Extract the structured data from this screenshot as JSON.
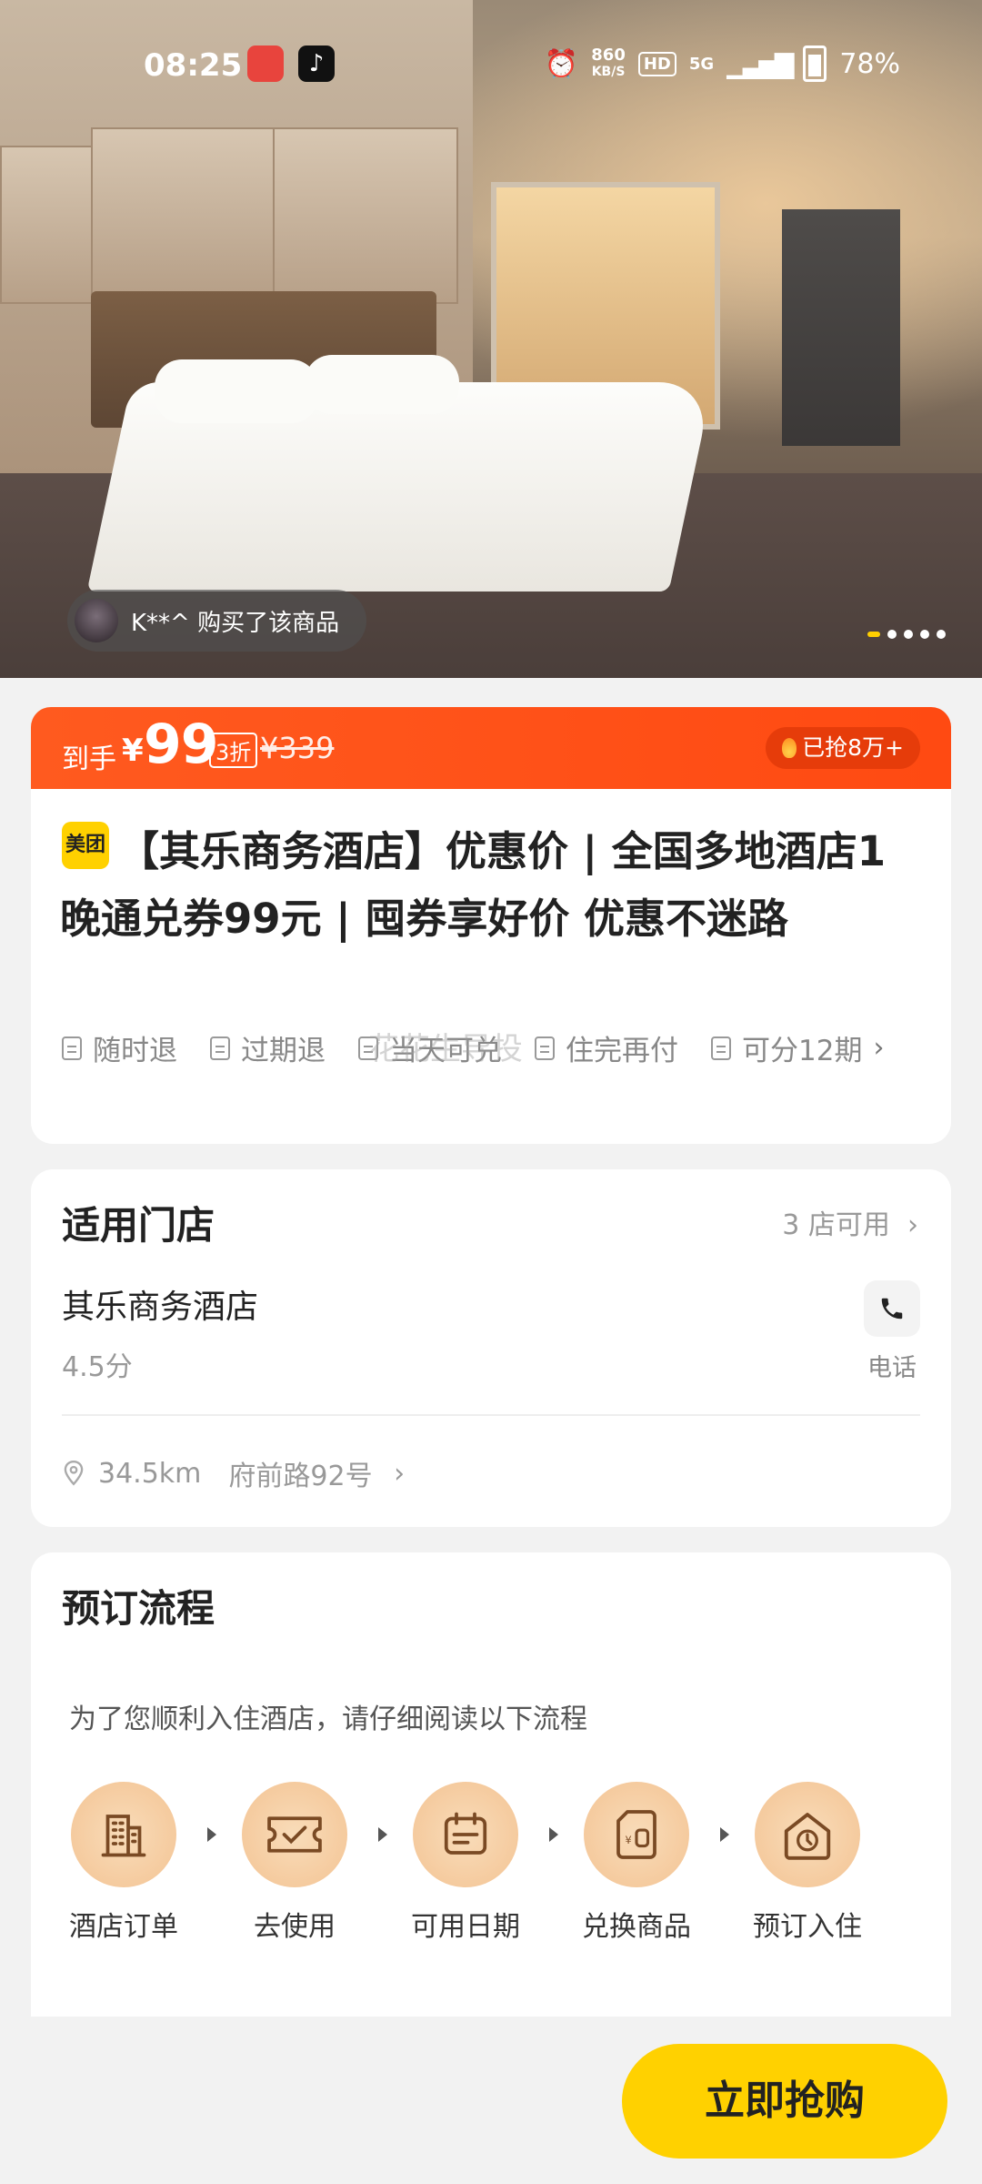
{
  "status_bar": {
    "time": "08:25",
    "net_speed_value": "860",
    "net_speed_unit": "KB/S",
    "hd": "HD",
    "network": "5G",
    "battery": "78%"
  },
  "hero": {
    "buyer_text": "K**^ 购买了该商品",
    "carousel_pages": 5,
    "carousel_active": 0
  },
  "price": {
    "label": "到手",
    "currency": "¥",
    "amount": "99",
    "discount": "3折",
    "original": "¥339",
    "sold": "已抢8万+"
  },
  "product": {
    "brand_logo": "美团",
    "title": "【其乐商务酒店】优惠价 | 全国多地酒店1晚通兑券99元 | 囤券享好价 优惠不迷路",
    "tags": [
      "随时退",
      "过期退",
      "当天可兑",
      "住完再付",
      "可分12期"
    ]
  },
  "store": {
    "section_title": "适用门店",
    "available": "3 店可用",
    "name": "其乐商务酒店",
    "score": "4.5分",
    "phone_label": "电话",
    "distance": "34.5km",
    "address": "府前路92号"
  },
  "flow": {
    "section_title": "预订流程",
    "note": "为了您顺利入住酒店，请仔细阅读以下流程",
    "steps": [
      "酒店订单",
      "去使用",
      "可用日期",
      "兑换商品",
      "预订入住"
    ]
  },
  "footer": {
    "buy_label": "立即抢购"
  },
  "watermark": "花花生导投",
  "colors": {
    "accent_orange": "#ff5a1f",
    "brand_yellow": "#ffd100"
  }
}
